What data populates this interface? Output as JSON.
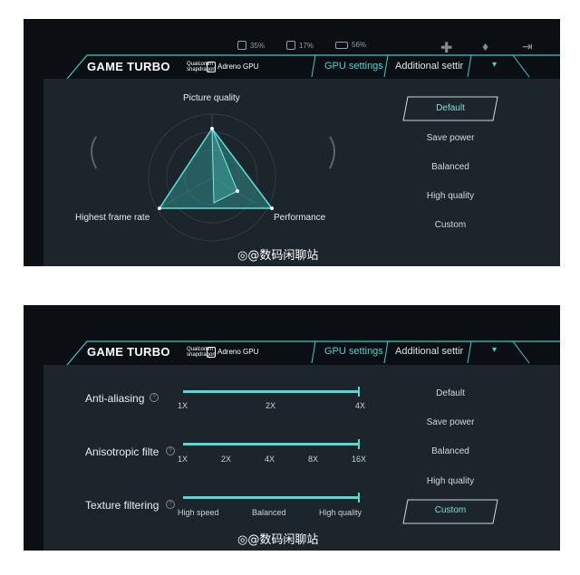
{
  "status": {
    "cpu": "35%",
    "gpu": "17%",
    "battery": "56%"
  },
  "header": {
    "brand": "GAME TURBO",
    "qualcomm_1": "Qualcomm",
    "qualcomm_2": "snapdragon",
    "gpu_name": "Adreno GPU",
    "tabs": [
      "GPU settings",
      "Additional settir"
    ]
  },
  "presets": [
    "Default",
    "Save power",
    "Balanced",
    "High quality",
    "Custom"
  ],
  "panel1": {
    "selected_preset": "Default",
    "radar": {
      "top": "Picture quality",
      "left": "Highest frame rate",
      "right": "Performance"
    }
  },
  "panel2": {
    "selected_preset": "Custom",
    "sliders": [
      {
        "label": "Anti-aliasing",
        "ticks": [
          "1X",
          "2X",
          "4X"
        ],
        "value_fraction": 1.0
      },
      {
        "label": "Anisotropic filte",
        "ticks": [
          "1X",
          "2X",
          "4X",
          "8X",
          "16X"
        ],
        "value_fraction": 1.0
      },
      {
        "label": "Texture filtering",
        "ticks": [
          "High speed",
          "Balanced",
          "High quality"
        ],
        "value_fraction": 1.0
      }
    ]
  },
  "watermark": "@数码闲聊站",
  "colors": {
    "accent": "#46d4cf",
    "panel_bg": "#1d252c",
    "frame_bg": "#0b0f14"
  }
}
